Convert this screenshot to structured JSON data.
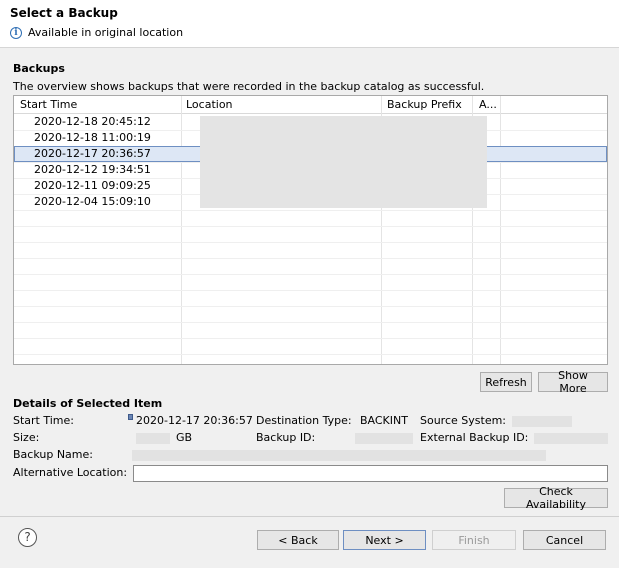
{
  "header": {
    "title": "Select a Backup",
    "info_text": "Available in original location"
  },
  "backups": {
    "title": "Backups",
    "description": "The overview shows backups that were recorded in the backup catalog as successful.",
    "columns": [
      "Start Time",
      "Location",
      "Backup Prefix",
      "A..."
    ],
    "rows": [
      {
        "start_time": "2020-12-18 20:45:12",
        "status": "diamond"
      },
      {
        "start_time": "2020-12-18 11:00:19",
        "status": "diamond"
      },
      {
        "start_time": "2020-12-17 20:36:57",
        "status": "available",
        "selected": true
      },
      {
        "start_time": "2020-12-12 19:34:51",
        "status": "diamond"
      },
      {
        "start_time": "2020-12-11 09:09:25",
        "status": "diamond"
      },
      {
        "start_time": "2020-12-04 15:09:10",
        "status": "diamond"
      }
    ],
    "status_colors": {
      "available": "#1db31d",
      "diamond": "#eef3fa"
    },
    "refresh_label": "Refresh",
    "show_more_label": "Show More"
  },
  "details": {
    "title": "Details of Selected Item",
    "start_time_label": "Start Time:",
    "start_time_value": "2020-12-17 20:36:57",
    "destination_type_label": "Destination Type:",
    "destination_type_value": "BACKINT",
    "source_system_label": "Source System:",
    "size_label": "Size:",
    "size_unit": "GB",
    "backup_id_label": "Backup ID:",
    "external_backup_id_label": "External Backup ID:",
    "backup_name_label": "Backup Name:",
    "alternative_location_label": "Alternative Location:",
    "alternative_location_value": "",
    "check_availability_label": "Check Availability"
  },
  "footer": {
    "help_icon": "question-icon",
    "back_label": "< Back",
    "next_label": "Next >",
    "finish_label": "Finish",
    "cancel_label": "Cancel"
  }
}
